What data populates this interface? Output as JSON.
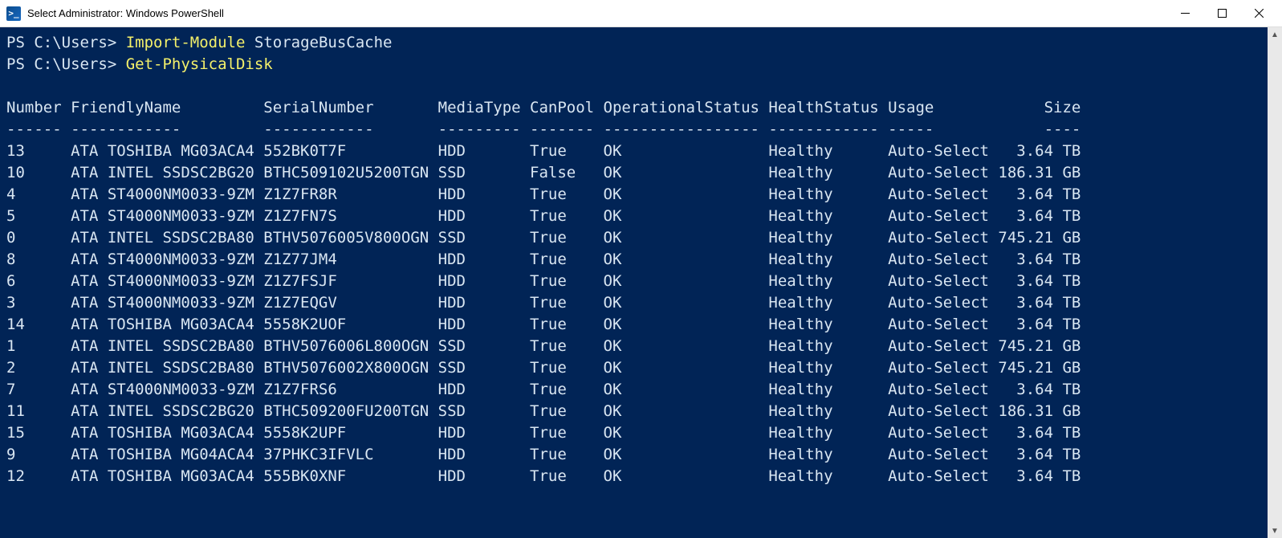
{
  "window": {
    "title": "Select Administrator: Windows PowerShell",
    "icon_glyph": "≥_"
  },
  "commands": [
    {
      "prompt": "PS C:\\Users> ",
      "cmd": "Import-Module",
      "arg": " StorageBusCache"
    },
    {
      "prompt": "PS C:\\Users> ",
      "cmd": "Get-PhysicalDisk",
      "arg": ""
    }
  ],
  "table": {
    "headers": [
      "Number",
      "FriendlyName",
      "SerialNumber",
      "MediaType",
      "CanPool",
      "OperationalStatus",
      "HealthStatus",
      "Usage",
      "Size"
    ],
    "underlines": [
      "------",
      "------------",
      "------------",
      "---------",
      "-------",
      "-----------------",
      "------------",
      "-----",
      "----"
    ],
    "rows": [
      {
        "Number": "13",
        "FriendlyName": "ATA TOSHIBA MG03ACA4",
        "SerialNumber": "552BK0T7F",
        "MediaType": "HDD",
        "CanPool": "True",
        "OperationalStatus": "OK",
        "HealthStatus": "Healthy",
        "Usage": "Auto-Select",
        "Size": "3.64 TB"
      },
      {
        "Number": "10",
        "FriendlyName": "ATA INTEL SSDSC2BG20",
        "SerialNumber": "BTHC509102U5200TGN",
        "MediaType": "SSD",
        "CanPool": "False",
        "OperationalStatus": "OK",
        "HealthStatus": "Healthy",
        "Usage": "Auto-Select",
        "Size": "186.31 GB"
      },
      {
        "Number": "4",
        "FriendlyName": "ATA ST4000NM0033-9ZM",
        "SerialNumber": "Z1Z7FR8R",
        "MediaType": "HDD",
        "CanPool": "True",
        "OperationalStatus": "OK",
        "HealthStatus": "Healthy",
        "Usage": "Auto-Select",
        "Size": "3.64 TB"
      },
      {
        "Number": "5",
        "FriendlyName": "ATA ST4000NM0033-9ZM",
        "SerialNumber": "Z1Z7FN7S",
        "MediaType": "HDD",
        "CanPool": "True",
        "OperationalStatus": "OK",
        "HealthStatus": "Healthy",
        "Usage": "Auto-Select",
        "Size": "3.64 TB"
      },
      {
        "Number": "0",
        "FriendlyName": "ATA INTEL SSDSC2BA80",
        "SerialNumber": "BTHV5076005V800OGN",
        "MediaType": "SSD",
        "CanPool": "True",
        "OperationalStatus": "OK",
        "HealthStatus": "Healthy",
        "Usage": "Auto-Select",
        "Size": "745.21 GB"
      },
      {
        "Number": "8",
        "FriendlyName": "ATA ST4000NM0033-9ZM",
        "SerialNumber": "Z1Z77JM4",
        "MediaType": "HDD",
        "CanPool": "True",
        "OperationalStatus": "OK",
        "HealthStatus": "Healthy",
        "Usage": "Auto-Select",
        "Size": "3.64 TB"
      },
      {
        "Number": "6",
        "FriendlyName": "ATA ST4000NM0033-9ZM",
        "SerialNumber": "Z1Z7FSJF",
        "MediaType": "HDD",
        "CanPool": "True",
        "OperationalStatus": "OK",
        "HealthStatus": "Healthy",
        "Usage": "Auto-Select",
        "Size": "3.64 TB"
      },
      {
        "Number": "3",
        "FriendlyName": "ATA ST4000NM0033-9ZM",
        "SerialNumber": "Z1Z7EQGV",
        "MediaType": "HDD",
        "CanPool": "True",
        "OperationalStatus": "OK",
        "HealthStatus": "Healthy",
        "Usage": "Auto-Select",
        "Size": "3.64 TB"
      },
      {
        "Number": "14",
        "FriendlyName": "ATA TOSHIBA MG03ACA4",
        "SerialNumber": "5558K2UOF",
        "MediaType": "HDD",
        "CanPool": "True",
        "OperationalStatus": "OK",
        "HealthStatus": "Healthy",
        "Usage": "Auto-Select",
        "Size": "3.64 TB"
      },
      {
        "Number": "1",
        "FriendlyName": "ATA INTEL SSDSC2BA80",
        "SerialNumber": "BTHV5076006L800OGN",
        "MediaType": "SSD",
        "CanPool": "True",
        "OperationalStatus": "OK",
        "HealthStatus": "Healthy",
        "Usage": "Auto-Select",
        "Size": "745.21 GB"
      },
      {
        "Number": "2",
        "FriendlyName": "ATA INTEL SSDSC2BA80",
        "SerialNumber": "BTHV5076002X800OGN",
        "MediaType": "SSD",
        "CanPool": "True",
        "OperationalStatus": "OK",
        "HealthStatus": "Healthy",
        "Usage": "Auto-Select",
        "Size": "745.21 GB"
      },
      {
        "Number": "7",
        "FriendlyName": "ATA ST4000NM0033-9ZM",
        "SerialNumber": "Z1Z7FRS6",
        "MediaType": "HDD",
        "CanPool": "True",
        "OperationalStatus": "OK",
        "HealthStatus": "Healthy",
        "Usage": "Auto-Select",
        "Size": "3.64 TB"
      },
      {
        "Number": "11",
        "FriendlyName": "ATA INTEL SSDSC2BG20",
        "SerialNumber": "BTHC509200FU200TGN",
        "MediaType": "SSD",
        "CanPool": "True",
        "OperationalStatus": "OK",
        "HealthStatus": "Healthy",
        "Usage": "Auto-Select",
        "Size": "186.31 GB"
      },
      {
        "Number": "15",
        "FriendlyName": "ATA TOSHIBA MG03ACA4",
        "SerialNumber": "5558K2UPF",
        "MediaType": "HDD",
        "CanPool": "True",
        "OperationalStatus": "OK",
        "HealthStatus": "Healthy",
        "Usage": "Auto-Select",
        "Size": "3.64 TB"
      },
      {
        "Number": "9",
        "FriendlyName": "ATA TOSHIBA MG04ACA4",
        "SerialNumber": "37PHKC3IFVLC",
        "MediaType": "HDD",
        "CanPool": "True",
        "OperationalStatus": "OK",
        "HealthStatus": "Healthy",
        "Usage": "Auto-Select",
        "Size": "3.64 TB"
      },
      {
        "Number": "12",
        "FriendlyName": "ATA TOSHIBA MG03ACA4",
        "SerialNumber": "555BK0XNF",
        "MediaType": "HDD",
        "CanPool": "True",
        "OperationalStatus": "OK",
        "HealthStatus": "Healthy",
        "Usage": "Auto-Select",
        "Size": "3.64 TB"
      }
    ]
  },
  "col_widths": {
    "Number": 7,
    "FriendlyName": 21,
    "SerialNumber": 19,
    "MediaType": 10,
    "CanPool": 8,
    "OperationalStatus": 18,
    "HealthStatus": 13,
    "Usage": 12,
    "Size": 9
  }
}
